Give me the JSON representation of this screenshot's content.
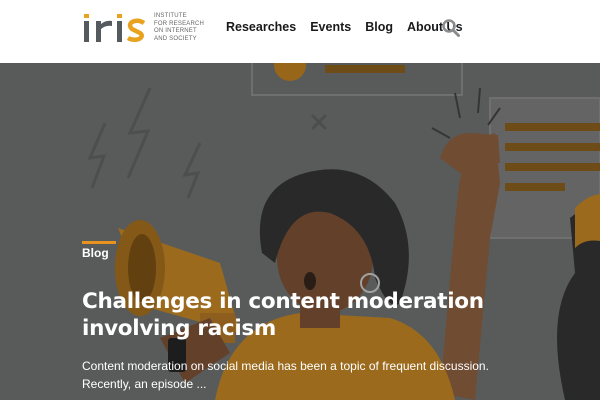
{
  "brand": {
    "logo_word": "iris",
    "tagline_lines": [
      "INSTITUTE",
      "FOR RESEARCH",
      "ON INTERNET",
      "AND SOCIETY"
    ],
    "colors": {
      "dark": "#555a5e",
      "accent": "#e8a21e"
    }
  },
  "nav": {
    "items": [
      {
        "label": "Researches"
      },
      {
        "label": "Events"
      },
      {
        "label": "Blog"
      },
      {
        "label": "About Us"
      }
    ],
    "search_icon": "search-icon"
  },
  "hero": {
    "category": "Blog",
    "title": "Challenges in content moderation involving racism",
    "excerpt": "Content moderation on social media has been a topic of frequent discussion. Recently, an episode ...",
    "accent_color": "#e8931e"
  }
}
